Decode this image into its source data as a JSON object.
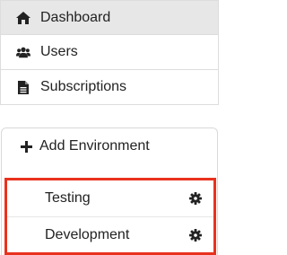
{
  "nav": {
    "items": [
      {
        "label": "Dashboard",
        "icon": "home-icon",
        "active": true
      },
      {
        "label": "Users",
        "icon": "users-icon",
        "active": false
      },
      {
        "label": "Subscriptions",
        "icon": "document-icon",
        "active": false
      }
    ]
  },
  "environments": {
    "add_label": "Add Environment",
    "items": [
      {
        "label": "Testing",
        "icon": "gear-icon"
      },
      {
        "label": "Development",
        "icon": "gear-icon"
      }
    ]
  },
  "colors": {
    "highlight_border": "#e8321e",
    "active_background": "#e7e7e7"
  }
}
